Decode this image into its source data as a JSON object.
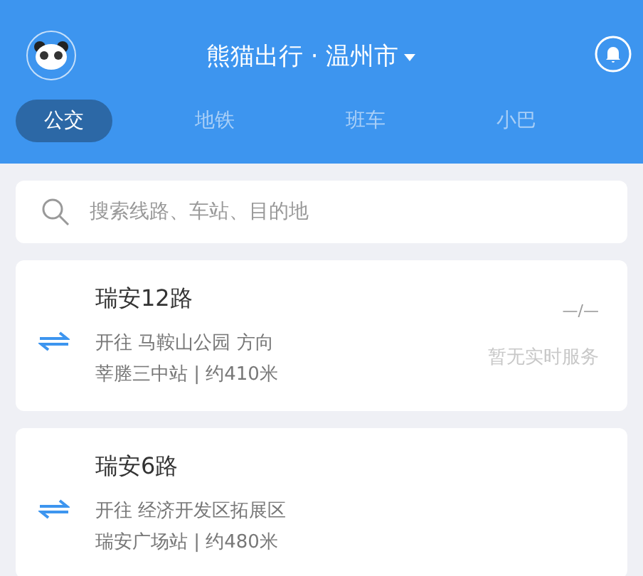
{
  "header": {
    "title": "熊猫出行 · 温州市"
  },
  "tabs": [
    {
      "label": "公交",
      "selected": true
    },
    {
      "label": "地铁",
      "selected": false
    },
    {
      "label": "班车",
      "selected": false
    },
    {
      "label": "小巴",
      "selected": false
    }
  ],
  "search": {
    "placeholder": "搜索线路、车站、目的地"
  },
  "routes": [
    {
      "name": "瑞安12路",
      "direction": "开往 马鞍山公园 方向",
      "stop": "莘塍三中站 | 约410米",
      "time": "—/—",
      "status": "暂无实时服务"
    },
    {
      "name": "瑞安6路",
      "direction": "开往 经济开发区拓展区",
      "stop": "瑞安广场站 | 约480米"
    }
  ]
}
